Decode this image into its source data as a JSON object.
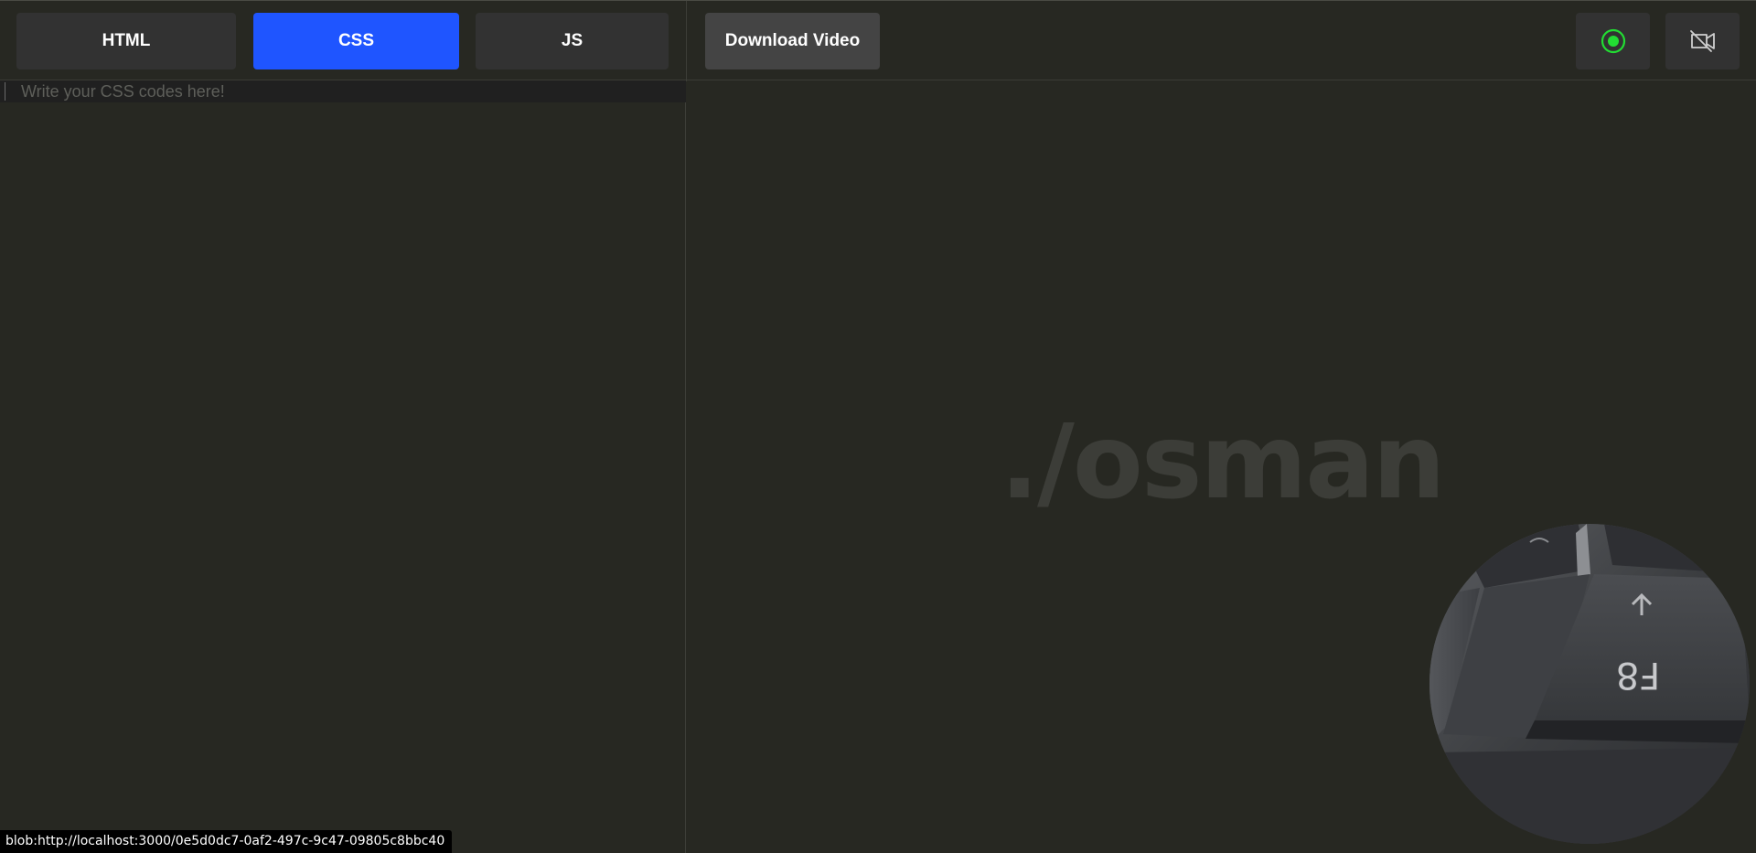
{
  "tabs": [
    {
      "label": "HTML",
      "active": false
    },
    {
      "label": "CSS",
      "active": true
    },
    {
      "label": "JS",
      "active": false
    }
  ],
  "toolbar": {
    "download_label": "Download Video",
    "record_icon": "record-icon",
    "camera_icon": "camera-off-icon"
  },
  "editor": {
    "placeholder": "Write your CSS codes here!",
    "value": ""
  },
  "preview": {
    "watermark": "./osman"
  },
  "webcam": {
    "key_label": "F8"
  },
  "status": {
    "url": "blob:http://localhost:3000/0e5d0dc7-0af2-497c-9c47-09805c8bbc40"
  },
  "colors": {
    "background": "#272822",
    "active_tab": "#1f55ff",
    "tab": "#323232",
    "download_button": "#444444",
    "record_accent": "#22dd33"
  }
}
